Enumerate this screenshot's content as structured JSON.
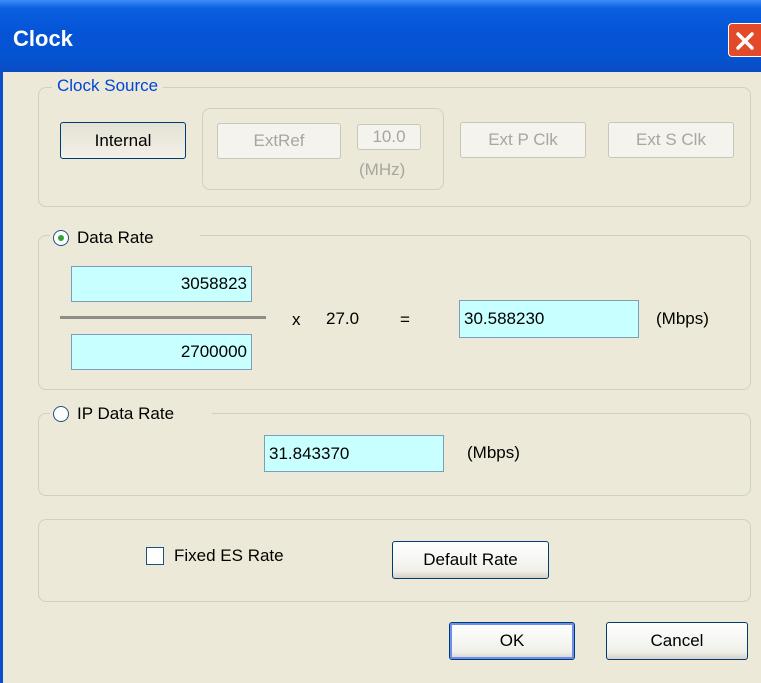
{
  "window": {
    "title": "Clock"
  },
  "clock_source": {
    "legend": "Clock Source",
    "internal_label": "Internal",
    "extref_label": "ExtRef",
    "extref_freq": "10.0",
    "extref_unit": "(MHz)",
    "ext_p_clk_label": "Ext P Clk",
    "ext_s_clk_label": "Ext S Clk"
  },
  "data_rate": {
    "legend": "Data Rate",
    "selected": true,
    "numerator": "3058823",
    "denominator": "2700000",
    "times": "x",
    "multiplier": "27.0",
    "equals": "=",
    "result": "30.588230",
    "unit": "(Mbps)"
  },
  "ip_data_rate": {
    "legend": "IP Data Rate",
    "selected": false,
    "value": "31.843370",
    "unit": "(Mbps)"
  },
  "options": {
    "fixed_es_rate_label": "Fixed ES Rate",
    "fixed_es_rate_checked": false,
    "default_rate_label": "Default Rate"
  },
  "footer": {
    "ok_label": "OK",
    "cancel_label": "Cancel"
  },
  "colors": {
    "titlebar": "#0554d6",
    "field_bg": "#c8ffff",
    "accent": "#0046d5",
    "close": "#e34a2a"
  }
}
